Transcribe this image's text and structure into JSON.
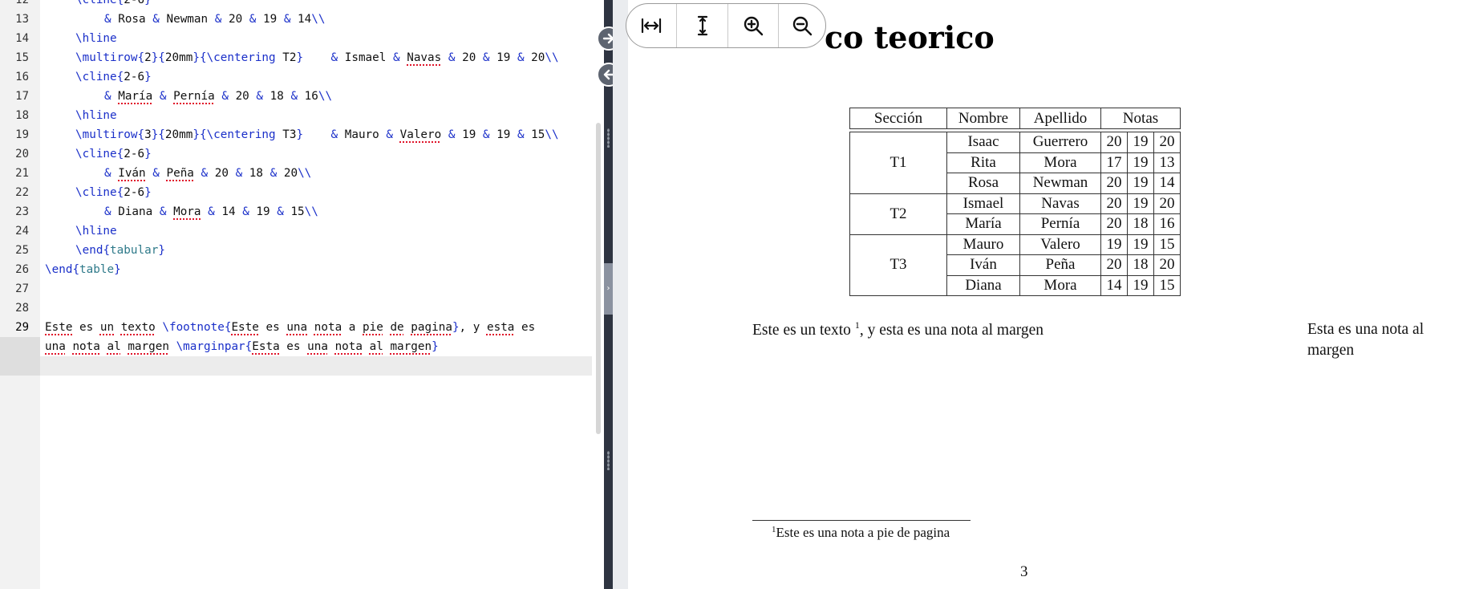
{
  "editor": {
    "lines": [
      {
        "num": "12",
        "tokens": [
          [
            "cmd",
            "\\cline"
          ],
          [
            "br",
            "{"
          ],
          [
            "txt",
            "2-6"
          ],
          [
            "br",
            "}"
          ]
        ]
      },
      {
        "num": "13",
        "tokens": [
          [
            "amp",
            "&"
          ],
          [
            "txt",
            " Rosa "
          ],
          [
            "amp",
            "&"
          ],
          [
            "txt",
            " Newman "
          ],
          [
            "amp",
            "&"
          ],
          [
            "txt",
            " 20 "
          ],
          [
            "amp",
            "&"
          ],
          [
            "txt",
            " 19 "
          ],
          [
            "amp",
            "&"
          ],
          [
            "txt",
            " 14"
          ],
          [
            "cmd",
            "\\\\"
          ]
        ]
      },
      {
        "num": "14",
        "tokens": [
          [
            "cmd",
            "\\hline"
          ]
        ]
      },
      {
        "num": "15",
        "tokens": [
          [
            "cmd",
            "\\multirow"
          ],
          [
            "br",
            "{"
          ],
          [
            "txt",
            "2"
          ],
          [
            "br",
            "}{"
          ],
          [
            "txt",
            "20mm"
          ],
          [
            "br",
            "}{"
          ],
          [
            "cmd",
            "\\centering"
          ],
          [
            "txt",
            " T2"
          ],
          [
            "br",
            "}"
          ],
          [
            "txt",
            "    "
          ],
          [
            "amp",
            "&"
          ],
          [
            "txt",
            " Ismael "
          ],
          [
            "amp",
            "&"
          ],
          [
            "txt",
            " "
          ],
          [
            "sp",
            "Navas"
          ],
          [
            "txt",
            " "
          ],
          [
            "amp",
            "&"
          ],
          [
            "txt",
            " 20 "
          ],
          [
            "amp",
            "&"
          ],
          [
            "txt",
            " 19 "
          ],
          [
            "amp",
            "&"
          ],
          [
            "txt",
            " 20"
          ],
          [
            "cmd",
            "\\\\"
          ]
        ]
      },
      {
        "num": "16",
        "tokens": [
          [
            "cmd",
            "\\cline"
          ],
          [
            "br",
            "{"
          ],
          [
            "txt",
            "2-6"
          ],
          [
            "br",
            "}"
          ]
        ]
      },
      {
        "num": "17",
        "tokens": [
          [
            "amp",
            "&"
          ],
          [
            "txt",
            " "
          ],
          [
            "sp",
            "María"
          ],
          [
            "txt",
            " "
          ],
          [
            "amp",
            "&"
          ],
          [
            "txt",
            " "
          ],
          [
            "sp",
            "Pernía"
          ],
          [
            "txt",
            " "
          ],
          [
            "amp",
            "&"
          ],
          [
            "txt",
            " 20 "
          ],
          [
            "amp",
            "&"
          ],
          [
            "txt",
            " 18 "
          ],
          [
            "amp",
            "&"
          ],
          [
            "txt",
            " 16"
          ],
          [
            "cmd",
            "\\\\"
          ]
        ]
      },
      {
        "num": "18",
        "tokens": [
          [
            "cmd",
            "\\hline"
          ]
        ]
      },
      {
        "num": "19",
        "tokens": [
          [
            "cmd",
            "\\multirow"
          ],
          [
            "br",
            "{"
          ],
          [
            "txt",
            "3"
          ],
          [
            "br",
            "}{"
          ],
          [
            "txt",
            "20mm"
          ],
          [
            "br",
            "}{"
          ],
          [
            "cmd",
            "\\centering"
          ],
          [
            "txt",
            " T3"
          ],
          [
            "br",
            "}"
          ],
          [
            "txt",
            "    "
          ],
          [
            "amp",
            "&"
          ],
          [
            "txt",
            " Mauro "
          ],
          [
            "amp",
            "&"
          ],
          [
            "txt",
            " "
          ],
          [
            "sp",
            "Valero"
          ],
          [
            "txt",
            " "
          ],
          [
            "amp",
            "&"
          ],
          [
            "txt",
            " 19 "
          ],
          [
            "amp",
            "&"
          ],
          [
            "txt",
            " 19 "
          ],
          [
            "amp",
            "&"
          ],
          [
            "txt",
            " 15"
          ],
          [
            "cmd",
            "\\\\"
          ]
        ]
      },
      {
        "num": "20",
        "tokens": [
          [
            "cmd",
            "\\cline"
          ],
          [
            "br",
            "{"
          ],
          [
            "txt",
            "2-6"
          ],
          [
            "br",
            "}"
          ]
        ]
      },
      {
        "num": "21",
        "tokens": [
          [
            "amp",
            "&"
          ],
          [
            "txt",
            " "
          ],
          [
            "sp",
            "Iván"
          ],
          [
            "txt",
            " "
          ],
          [
            "amp",
            "&"
          ],
          [
            "txt",
            " "
          ],
          [
            "sp",
            "Peña"
          ],
          [
            "txt",
            " "
          ],
          [
            "amp",
            "&"
          ],
          [
            "txt",
            " 20 "
          ],
          [
            "amp",
            "&"
          ],
          [
            "txt",
            " 18 "
          ],
          [
            "amp",
            "&"
          ],
          [
            "txt",
            " 20"
          ],
          [
            "cmd",
            "\\\\"
          ]
        ]
      },
      {
        "num": "22",
        "tokens": [
          [
            "cmd",
            "\\cline"
          ],
          [
            "br",
            "{"
          ],
          [
            "txt",
            "2-6"
          ],
          [
            "br",
            "}"
          ]
        ]
      },
      {
        "num": "23",
        "tokens": [
          [
            "amp",
            "&"
          ],
          [
            "txt",
            " Diana "
          ],
          [
            "amp",
            "&"
          ],
          [
            "txt",
            " "
          ],
          [
            "sp",
            "Mora"
          ],
          [
            "txt",
            " "
          ],
          [
            "amp",
            "&"
          ],
          [
            "txt",
            " 14 "
          ],
          [
            "amp",
            "&"
          ],
          [
            "txt",
            " 19 "
          ],
          [
            "amp",
            "&"
          ],
          [
            "txt",
            " 15"
          ],
          [
            "cmd",
            "\\\\"
          ]
        ]
      },
      {
        "num": "24",
        "tokens": [
          [
            "cmd",
            "\\hline"
          ]
        ]
      },
      {
        "num": "25",
        "tokens": [
          [
            "cmd",
            "\\end"
          ],
          [
            "br",
            "{"
          ],
          [
            "env",
            "tabular"
          ],
          [
            "br",
            "}"
          ]
        ]
      },
      {
        "num": "26",
        "tokens": [
          [
            "cmd",
            "\\end"
          ],
          [
            "br",
            "{"
          ],
          [
            "env",
            "table"
          ],
          [
            "br",
            "}"
          ]
        ]
      },
      {
        "num": "27",
        "tokens": []
      },
      {
        "num": "28",
        "tokens": []
      },
      {
        "num": "29",
        "tokens": [
          [
            "sp",
            "Este"
          ],
          [
            "txt",
            " es "
          ],
          [
            "sp",
            "un"
          ],
          [
            "txt",
            " "
          ],
          [
            "sp",
            "texto"
          ],
          [
            "txt",
            " "
          ],
          [
            "cmd",
            "\\footnote"
          ],
          [
            "br",
            "{"
          ],
          [
            "sp",
            "Este"
          ],
          [
            "txt",
            " es "
          ],
          [
            "sp",
            "una"
          ],
          [
            "txt",
            " "
          ],
          [
            "sp",
            "nota"
          ],
          [
            "txt",
            " a "
          ],
          [
            "sp",
            "pie"
          ],
          [
            "txt",
            " "
          ],
          [
            "sp",
            "de"
          ],
          [
            "txt",
            " "
          ],
          [
            "sp",
            "pagina"
          ],
          [
            "br",
            "}"
          ],
          [
            "txt",
            ", y "
          ],
          [
            "sp",
            "esta"
          ],
          [
            "txt",
            " es"
          ]
        ]
      },
      {
        "num": "",
        "tokens": [
          [
            "sp",
            "una"
          ],
          [
            "txt",
            " "
          ],
          [
            "sp",
            "nota"
          ],
          [
            "txt",
            " "
          ],
          [
            "sp",
            "al"
          ],
          [
            "txt",
            " "
          ],
          [
            "sp",
            "margen"
          ],
          [
            "txt",
            " "
          ],
          [
            "cmd",
            "\\marginpar"
          ],
          [
            "br",
            "{"
          ],
          [
            "sp",
            "Esta"
          ],
          [
            "txt",
            " es "
          ],
          [
            "sp",
            "una"
          ],
          [
            "txt",
            " "
          ],
          [
            "sp",
            "nota"
          ],
          [
            "txt",
            " "
          ],
          [
            "sp",
            "al"
          ],
          [
            "txt",
            " "
          ],
          [
            "sp",
            "margen"
          ],
          [
            "br",
            "}"
          ]
        ]
      }
    ]
  },
  "preview": {
    "heading": "co teorico",
    "toolbar": {
      "fit_width": "fit-width-icon",
      "fit_height": "fit-height-icon",
      "zoom_in": "zoom-in-icon",
      "zoom_out": "zoom-out-icon"
    },
    "table": {
      "headers": [
        "Sección",
        "Nombre",
        "Apellido",
        "Notas"
      ],
      "groups": [
        {
          "section": "T1",
          "rows": [
            [
              "Isaac",
              "Guerrero",
              "20",
              "19",
              "20"
            ],
            [
              "Rita",
              "Mora",
              "17",
              "19",
              "13"
            ],
            [
              "Rosa",
              "Newman",
              "20",
              "19",
              "14"
            ]
          ]
        },
        {
          "section": "T2",
          "rows": [
            [
              "Ismael",
              "Navas",
              "20",
              "19",
              "20"
            ],
            [
              "María",
              "Pernía",
              "20",
              "18",
              "16"
            ]
          ]
        },
        {
          "section": "T3",
          "rows": [
            [
              "Mauro",
              "Valero",
              "19",
              "19",
              "15"
            ],
            [
              "Iván",
              "Peña",
              "20",
              "18",
              "20"
            ],
            [
              "Diana",
              "Mora",
              "14",
              "19",
              "15"
            ]
          ]
        }
      ]
    },
    "body_text_before": "Este es un texto ",
    "footnote_mark": "1",
    "body_text_after": ", y esta es una nota al margen",
    "margin_note": "Esta es una nota al margen",
    "footnote_text": "Este es una nota a pie de pagina",
    "page_number": "3"
  },
  "colors": {
    "command": "#1a2fc9",
    "environment": "#2f7a8a",
    "spell_underline": "#e0142a",
    "splitter": "#2e3441"
  }
}
